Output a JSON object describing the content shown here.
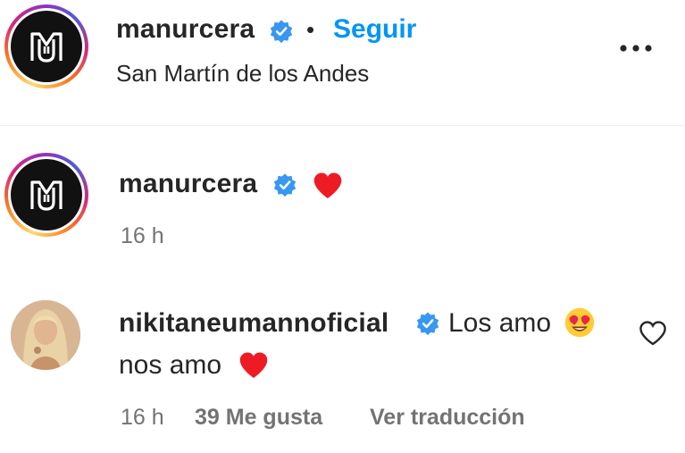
{
  "post_header": {
    "username": "manurcera",
    "separator": "•",
    "follow_label": "Seguir",
    "location": "San Martín de los Andes"
  },
  "caption": {
    "username": "manurcera",
    "time": "16 h"
  },
  "comment": {
    "username": "nikitaneumannoficial",
    "text_line1": "Los amo",
    "text_line2": "nos amo",
    "time": "16 h",
    "likes": "39 Me gusta",
    "translate_label": "Ver traducción"
  },
  "colors": {
    "accent_blue": "#0095f6",
    "verified_blue": "#3897f0",
    "heart_red": "#ed1c24",
    "muted_text": "#737373"
  },
  "icons": {
    "verified": "verified-badge-icon",
    "more": "more-options-icon",
    "heart": "red-heart-emoji-icon",
    "heart_eyes": "heart-eyes-emoji-icon",
    "like": "heart-outline-icon"
  }
}
